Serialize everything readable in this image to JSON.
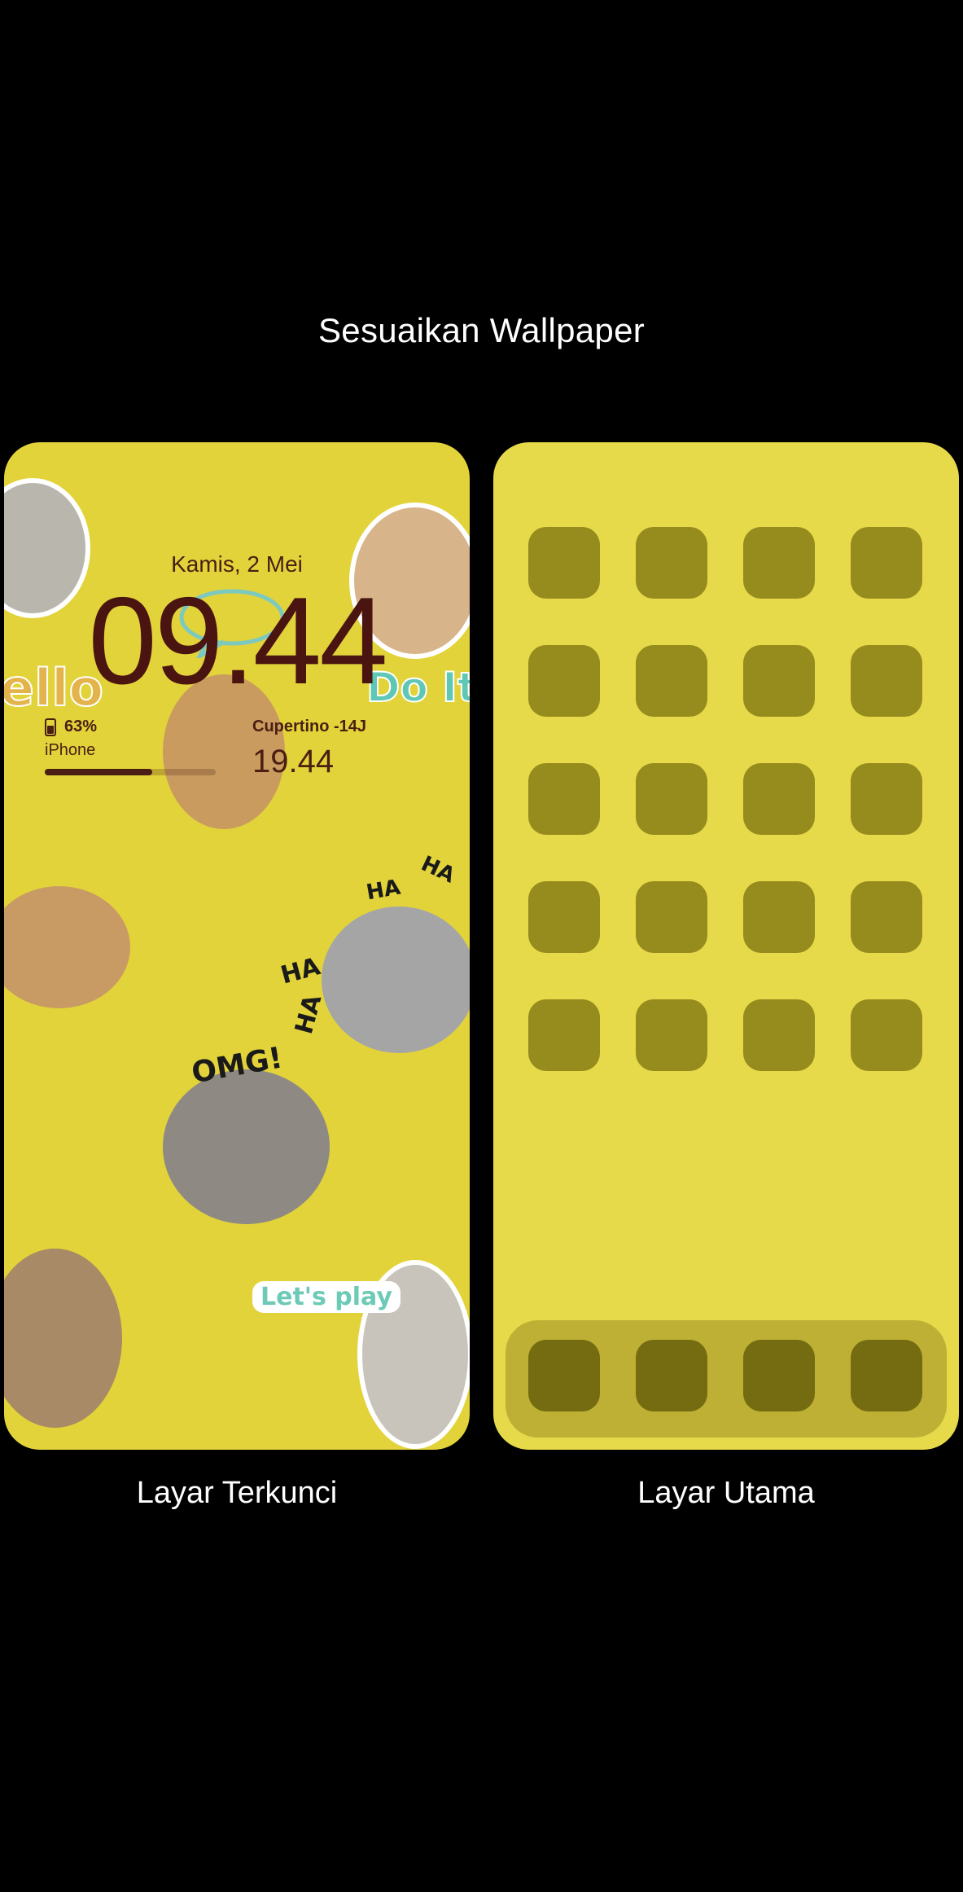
{
  "header": {
    "title": "Sesuaikan Wallpaper"
  },
  "lock_screen": {
    "caption": "Layar Terkunci",
    "date": "Kamis, 2 Mei",
    "time": "09.44",
    "battery_percent": "63%",
    "battery_level": 0.63,
    "device_name": "iPhone",
    "world_clock_city": "Cupertino -14J",
    "world_clock_time": "19.44",
    "stickers": {
      "hello": "ello",
      "doit": "Do It",
      "letsplay": "Let's play",
      "omg": "OMG!",
      "ha1": "HA",
      "ha2": "HA",
      "ha3": "HA",
      "ha4": "HA"
    }
  },
  "home_screen": {
    "caption": "Layar Utama",
    "grid_rows": 5,
    "grid_columns": 4,
    "dock_apps": 4
  },
  "colors": {
    "background": "#000000",
    "lock_wallpaper": "#e2d33a",
    "home_wallpaper": "#e6d94a",
    "app_placeholder": "#968b1d",
    "dock": "#bdb035",
    "dock_app": "#756b10",
    "clock_text": "#4a1410"
  }
}
